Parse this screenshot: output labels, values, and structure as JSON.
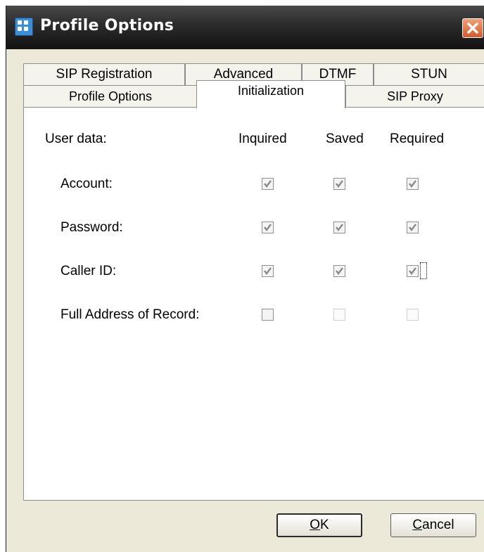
{
  "window": {
    "title": "Profile Options",
    "title_icon": "profile-grid-icon",
    "close_icon": "close-x-icon",
    "accent_color": "#d35b2a"
  },
  "tabs": {
    "row_back": [
      "SIP Registration",
      "Advanced",
      "DTMF",
      "STUN"
    ],
    "row_front": [
      "Profile Options",
      "Initialization",
      "SIP Proxy"
    ],
    "active": "Initialization"
  },
  "user_data": {
    "heading": "User data:",
    "columns": [
      "Inquired",
      "Saved",
      "Required"
    ],
    "rows": [
      {
        "label": "Account:",
        "inquired": {
          "checked": true,
          "enabled": false
        },
        "saved": {
          "checked": true,
          "enabled": false
        },
        "required": {
          "checked": true,
          "enabled": false
        }
      },
      {
        "label": "Password:",
        "inquired": {
          "checked": true,
          "enabled": false
        },
        "saved": {
          "checked": true,
          "enabled": false
        },
        "required": {
          "checked": true,
          "enabled": false
        }
      },
      {
        "label": "Caller ID:",
        "inquired": {
          "checked": true,
          "enabled": false
        },
        "saved": {
          "checked": true,
          "enabled": false
        },
        "required": {
          "checked": true,
          "enabled": false,
          "focused": true
        }
      },
      {
        "label": "Full Address of Record:",
        "inquired": {
          "checked": false,
          "enabled": true
        },
        "saved": {
          "checked": false,
          "enabled": false
        },
        "required": {
          "checked": false,
          "enabled": false
        }
      }
    ]
  },
  "buttons": {
    "ok": {
      "label": "OK",
      "mnemonic": "O"
    },
    "cancel": {
      "label": "Cancel",
      "mnemonic": "C"
    }
  }
}
